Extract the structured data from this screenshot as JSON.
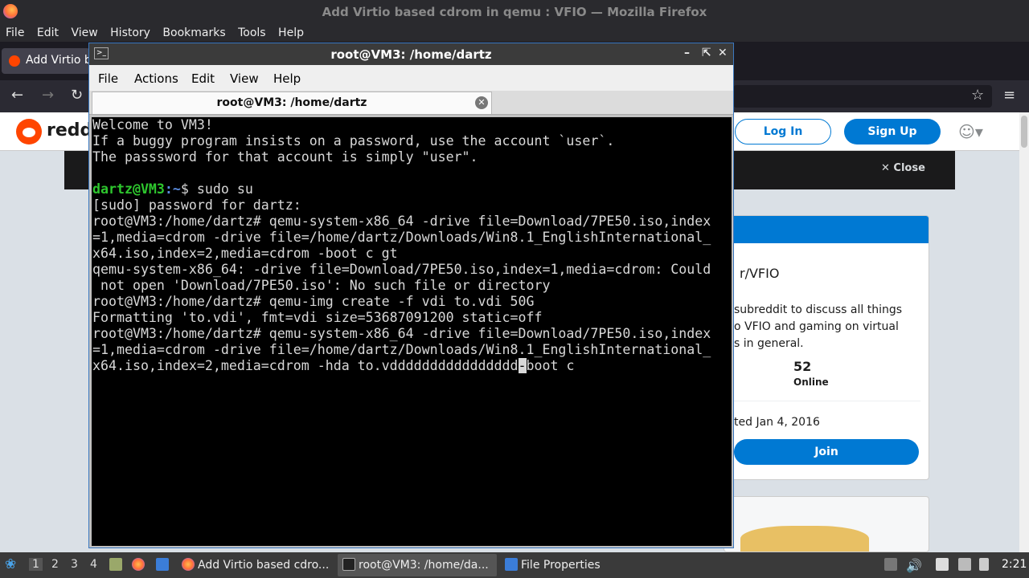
{
  "firefox": {
    "window_title": "Add Virtio based cdrom in qemu : VFIO — Mozilla Firefox",
    "menu": [
      "File",
      "Edit",
      "View",
      "History",
      "Bookmarks",
      "Tools",
      "Help"
    ],
    "tab_label": "Add Virtio b",
    "nav": {
      "back": "←",
      "forward": "→",
      "reload": "↻",
      "star": "☆",
      "menu": "≡"
    }
  },
  "reddit": {
    "wordmark": "reddi",
    "login_label": "Log In",
    "signup_label": "Sign Up",
    "close_label": "Close",
    "subreddit_name": "r/VFIO",
    "description": "subreddit to discuss all things\no VFIO and gaming on virtual\ns in general.",
    "online_count": "52",
    "online_label": "Online",
    "created": "ted Jan 4, 2016",
    "join_label": "Join",
    "accent": "#0079d3",
    "brand": "#ff4500"
  },
  "terminal": {
    "window_title": "root@VM3: /home/dartz",
    "menu": [
      "File",
      "Actions",
      "Edit",
      "View",
      "Help"
    ],
    "tab_label": "root@VM3: /home/dartz",
    "lines": [
      "Welcome to VM3!",
      "If a buggy program insists on a password, use the account `user`.",
      "The passsword for that account is simply \"user\".",
      "",
      "PROMPT",
      "[sudo] password for dartz:",
      "root@VM3:/home/dartz# qemu-system-x86_64 -drive file=Download/7PE50.iso,index",
      "=1,media=cdrom -drive file=/home/dartz/Downloads/Win8.1_EnglishInternational_",
      "x64.iso,index=2,media=cdrom -boot c gt",
      "qemu-system-x86_64: -drive file=Download/7PE50.iso,index=1,media=cdrom: Could",
      " not open 'Download/7PE50.iso': No such file or directory",
      "root@VM3:/home/dartz# qemu-img create -f vdi to.vdi 50G",
      "Formatting 'to.vdi', fmt=vdi size=53687091200 static=off",
      "root@VM3:/home/dartz# qemu-system-x86_64 -drive file=Download/7PE50.iso,index",
      "=1,media=cdrom -drive file=/home/dartz/Downloads/Win8.1_EnglishInternational_",
      "CURSORLINE"
    ],
    "prompt_user": "dartz@VM3",
    "prompt_path": ":~",
    "prompt_cmd": "$ sudo su",
    "last_line_before": "x64.iso,index=2,media=cdrom -hda to.vdddddddddddddddd",
    "cursor_char": "-",
    "last_line_after": "boot c"
  },
  "taskbar": {
    "workspaces": [
      "1",
      "2",
      "3",
      "4"
    ],
    "active_workspace": "1",
    "tasks": [
      {
        "label": "Add Virtio based cdro...",
        "icon": "firefox-icon"
      },
      {
        "label": "root@VM3: /home/da...",
        "icon": "terminal-icon"
      },
      {
        "label": "File Properties",
        "icon": "folder-icon"
      }
    ],
    "clock": "2:21"
  }
}
